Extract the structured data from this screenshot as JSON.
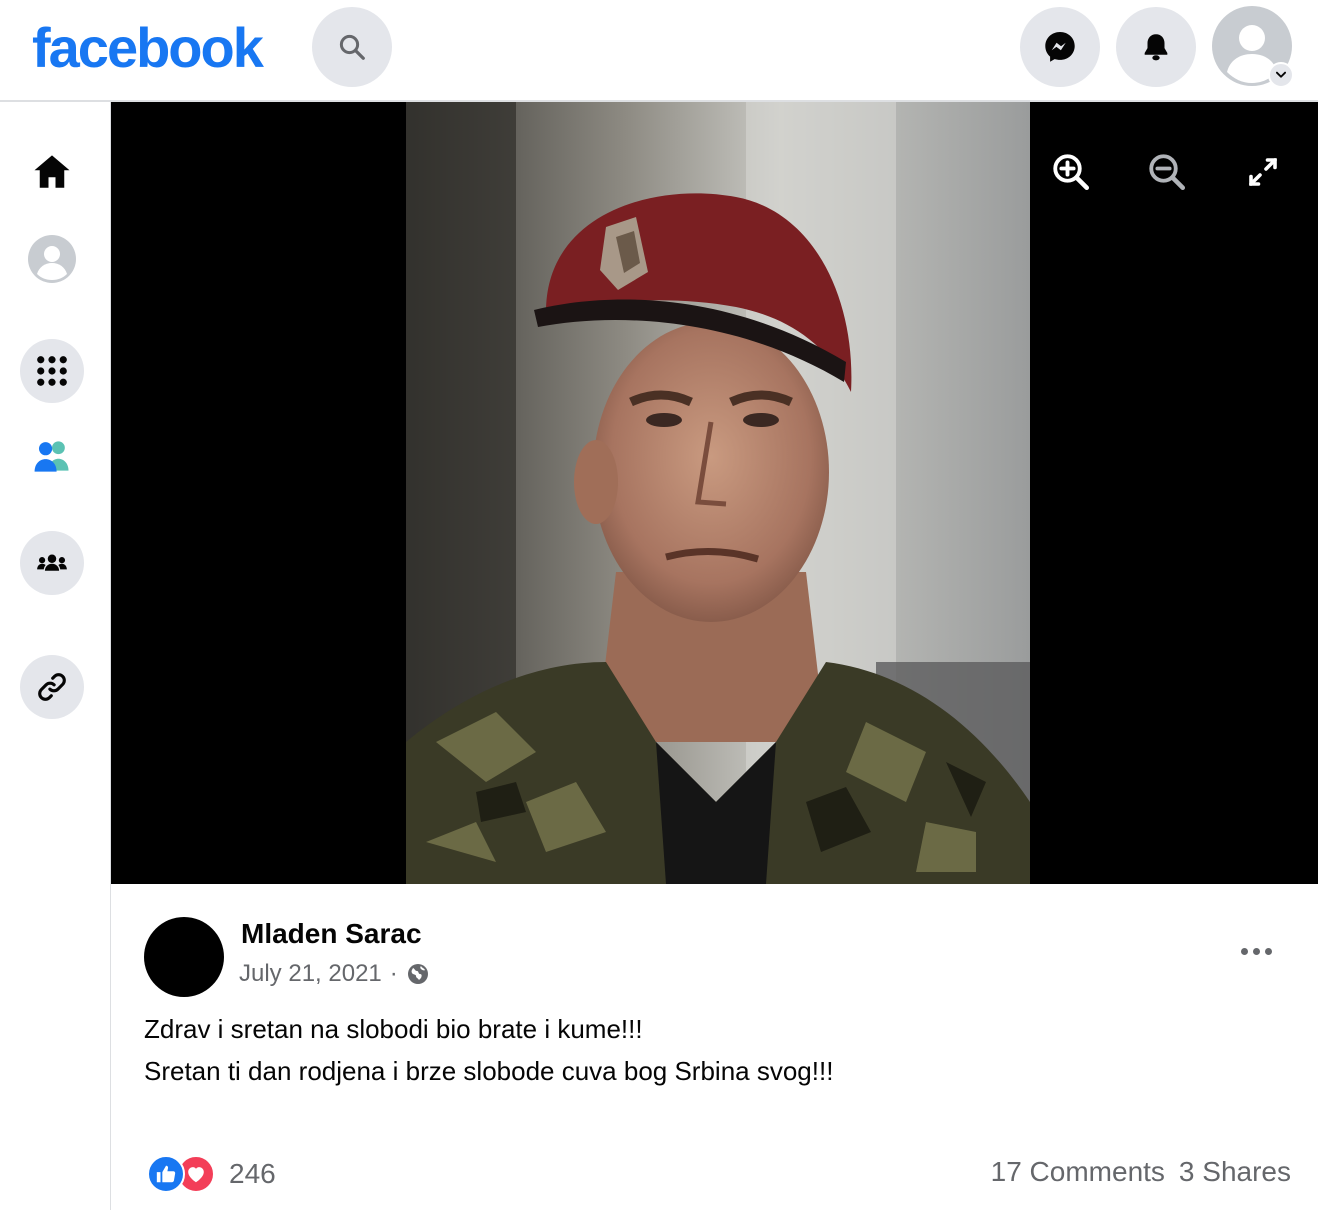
{
  "topbar": {
    "logo_text": "facebook",
    "brand_color": "#1877f2",
    "icons": [
      "search-icon",
      "messenger-icon",
      "bell-icon",
      "profile-avatar",
      "chevron-down-icon"
    ]
  },
  "leftrail": {
    "icons": [
      "home-icon",
      "profile-icon",
      "menu-grid-icon",
      "friends-icon",
      "groups-icon",
      "link-icon"
    ]
  },
  "viewer": {
    "controls": [
      "zoom-in-icon",
      "zoom-out-icon",
      "fullscreen-icon"
    ]
  },
  "post": {
    "author": "Mladen Sarac",
    "date": "July 21, 2021",
    "separator": "·",
    "audience_icon": "globe-icon",
    "text_lines": [
      "Zdrav i sretan na slobodi bio brate i kume!!!",
      "Sretan ti dan rodjena i brze slobode cuva bog Srbina svog!!!"
    ],
    "reaction_count": "246",
    "comments": "17 Comments",
    "shares": "3 Shares"
  }
}
